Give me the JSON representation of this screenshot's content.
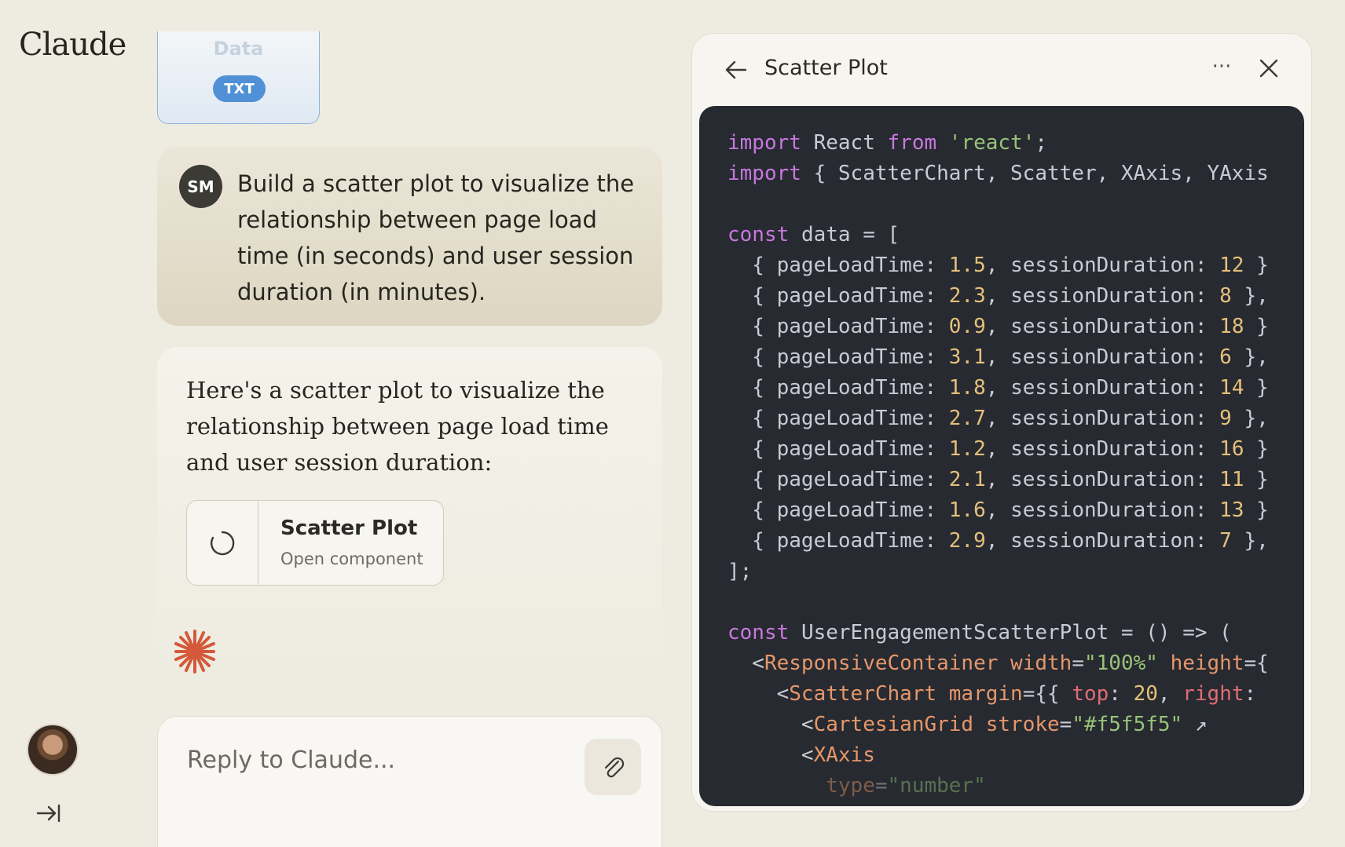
{
  "app": {
    "logo": "Claude"
  },
  "file_card": {
    "title_faded": "Data",
    "badge": "TXT"
  },
  "user_message": {
    "initials": "SM",
    "text": "Build a scatter plot to visualize the relationship between page load time (in seconds) and user session duration (in minutes)."
  },
  "assistant_message": {
    "text": "Here's a scatter plot to visualize the relationship between page load time and user session duration:",
    "artifact": {
      "title": "Scatter Plot",
      "subtitle": "Open component"
    }
  },
  "reply": {
    "placeholder": "Reply to Claude..."
  },
  "panel": {
    "title": "Scatter Plot",
    "more_label": "···",
    "code": {
      "import1": {
        "kw": "import",
        "name": "React",
        "from": "from",
        "module": "'react'",
        "semi": ";"
      },
      "import2": {
        "kw": "import",
        "rest": "{ ScatterChart, Scatter, XAxis, YAxis"
      },
      "const_data": {
        "kw": "const",
        "rest": "data = ["
      },
      "rows": [
        {
          "plt": "1.5",
          "sd": "12",
          "end": "}"
        },
        {
          "plt": "2.3",
          "sd": "8",
          "end": "},"
        },
        {
          "plt": "0.9",
          "sd": "18",
          "end": "}"
        },
        {
          "plt": "3.1",
          "sd": "6",
          "end": "},"
        },
        {
          "plt": "1.8",
          "sd": "14",
          "end": "}"
        },
        {
          "plt": "2.7",
          "sd": "9",
          "end": "},"
        },
        {
          "plt": "1.2",
          "sd": "16",
          "end": "}"
        },
        {
          "plt": "2.1",
          "sd": "11",
          "end": "}"
        },
        {
          "plt": "1.6",
          "sd": "13",
          "end": "}"
        },
        {
          "plt": "2.9",
          "sd": "7",
          "end": "},"
        }
      ],
      "keys": {
        "plt": "pageLoadTime:",
        "sd": "sessionDuration:"
      },
      "close_arr": "];",
      "const_comp": {
        "kw": "const",
        "rest": "UserEngagementScatterPlot = () => ("
      },
      "rc": {
        "tag": "ResponsiveContainer",
        "attr1": "width",
        "val1": "\"100%\"",
        "attr2": "height"
      },
      "sc": {
        "tag": "ScatterChart",
        "attr": "margin",
        "key1": "top",
        "num1": "20",
        "key2": "right"
      },
      "cg": {
        "tag": "CartesianGrid",
        "attr": "stroke",
        "val": "\"#f5f5f5\"",
        "icon": "↗"
      },
      "xa": {
        "tag": "XAxis"
      },
      "type_line": {
        "attr": "type",
        "val": "\"number\""
      }
    }
  },
  "colors": {
    "accent_spark": "#d4593a",
    "badge_blue": "#4f90d6",
    "code_bg": "#272a30"
  }
}
